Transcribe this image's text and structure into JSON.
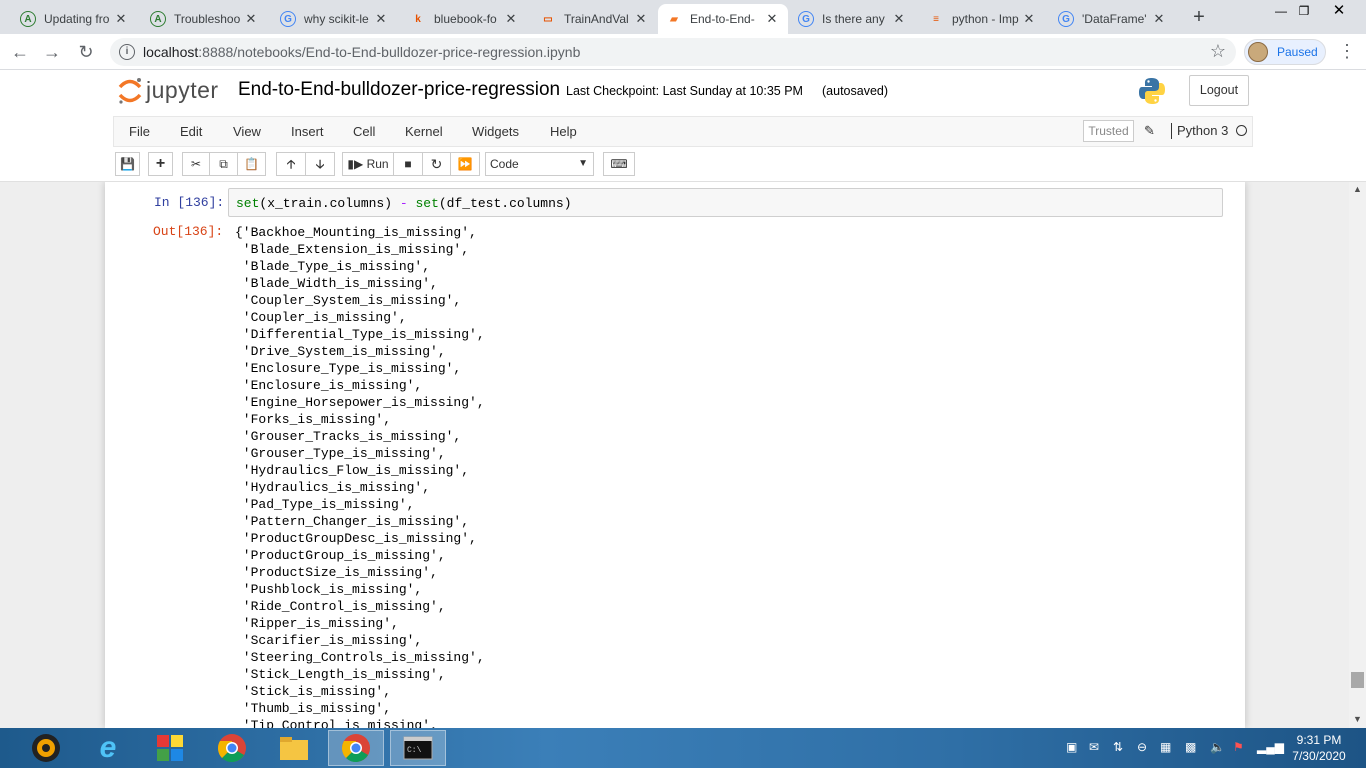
{
  "browser": {
    "tabs": [
      {
        "title": "Updating fro",
        "favicon": "a-circle-icon",
        "color": "#2e7d32"
      },
      {
        "title": "Troubleshoo",
        "favicon": "a-circle-icon",
        "color": "#2e7d32"
      },
      {
        "title": "why scikit-le",
        "favicon": "google-icon",
        "color": "#4285f4"
      },
      {
        "title": "bluebook-fo",
        "favicon": "kaggle-icon",
        "color": "#e65100"
      },
      {
        "title": "TrainAndVal",
        "favicon": "document-icon",
        "color": "#e65100"
      },
      {
        "title": "End-to-End-",
        "favicon": "jupyter-notebook-icon",
        "color": "#f37726"
      },
      {
        "title": "Is there any",
        "favicon": "google-icon",
        "color": "#4285f4"
      },
      {
        "title": "python - Imp",
        "favicon": "stackoverflow-icon",
        "color": "#e65100"
      },
      {
        "title": "'DataFrame'",
        "favicon": "google-icon",
        "color": "#4285f4"
      }
    ],
    "url_host": "localhost",
    "url_rest": ":8888/notebooks/End-to-End-bulldozer-price-regression.ipynb",
    "profile_status": "Paused"
  },
  "jupyter": {
    "logo_text": "jupyter",
    "notebook_name": "End-to-End-bulldozer-price-regression",
    "checkpoint": "Last Checkpoint: Last Sunday at 10:35 PM",
    "autosave": "(autosaved)",
    "logout_label": "Logout",
    "menu": [
      "File",
      "Edit",
      "View",
      "Insert",
      "Cell",
      "Kernel",
      "Widgets",
      "Help"
    ],
    "trusted_label": "Trusted",
    "kernel_name": "Python 3",
    "run_label": "Run",
    "cell_type": "Code"
  },
  "cell": {
    "in_prompt": "In [136]:",
    "code_parts": [
      "set",
      "(x_train.columns) ",
      "-",
      " ",
      "set",
      "(df_test.columns)"
    ],
    "out_prompt": "Out[136]:",
    "output_lines": [
      "{'Backhoe_Mounting_is_missing',",
      " 'Blade_Extension_is_missing',",
      " 'Blade_Type_is_missing',",
      " 'Blade_Width_is_missing',",
      " 'Coupler_System_is_missing',",
      " 'Coupler_is_missing',",
      " 'Differential_Type_is_missing',",
      " 'Drive_System_is_missing',",
      " 'Enclosure_Type_is_missing',",
      " 'Enclosure_is_missing',",
      " 'Engine_Horsepower_is_missing',",
      " 'Forks_is_missing',",
      " 'Grouser_Tracks_is_missing',",
      " 'Grouser_Type_is_missing',",
      " 'Hydraulics_Flow_is_missing',",
      " 'Hydraulics_is_missing',",
      " 'Pad_Type_is_missing',",
      " 'Pattern_Changer_is_missing',",
      " 'ProductGroupDesc_is_missing',",
      " 'ProductGroup_is_missing',",
      " 'ProductSize_is_missing',",
      " 'Pushblock_is_missing',",
      " 'Ride_Control_is_missing',",
      " 'Ripper_is_missing',",
      " 'Scarifier_is_missing',",
      " 'Steering_Controls_is_missing',",
      " 'Stick_Length_is_missing',",
      " 'Stick_is_missing',",
      " 'Thumb_is_missing',",
      " 'Tip_Control_is_missing',"
    ]
  },
  "taskbar": {
    "apps": [
      "media-player-icon",
      "internet-explorer-icon",
      "puzzle-app-icon",
      "chrome-icon",
      "file-explorer-icon",
      "chrome-notebook-icon",
      "command-prompt-icon"
    ],
    "time": "9:31 PM",
    "date": "7/30/2020"
  },
  "colors": {
    "jupyter_orange": "#f37726",
    "in_prompt": "#303f9f",
    "out_prompt": "#d84315",
    "builtin_green": "#008000"
  }
}
